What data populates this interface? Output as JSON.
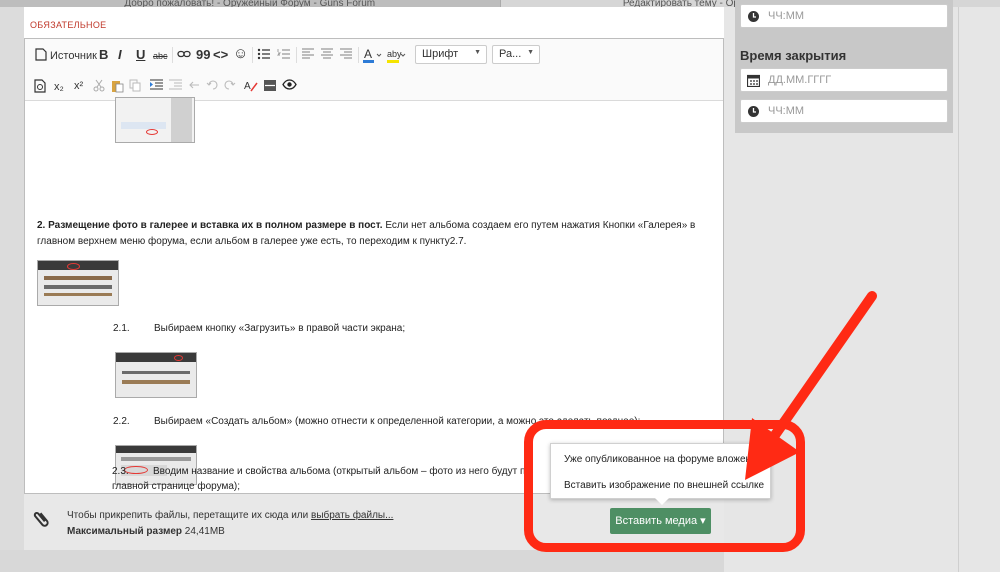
{
  "tabs": [
    "Добро пожаловать! - Оружейный Форум - Guns Forum",
    "Редактировать тему - Оружейный Форум - Guns Forum"
  ],
  "required_label": "ОБЯЗАТЕЛЬНОЕ",
  "toolbar": {
    "source_label": "Источник",
    "font_dropdown": "Шрифт",
    "size_dropdown": "Ра...",
    "bold": "B",
    "italic": "I",
    "underline": "U",
    "strike": "abc",
    "quote": "99",
    "code": "<>",
    "smiley": "☺",
    "subscript": "x₂",
    "superscript": "x²"
  },
  "content": {
    "p2_bold": "2. Размещение фото в галерее и вставка их в полном размере в пост.",
    "p2_text": " Если нет альбома создаем его путем нажатия Кнопки «Галерея» в главном верхнем меню форума, если альбом в галерее уже есть, то переходим к пункту2.7.",
    "s21_num": "2.1.",
    "s21_text": "Выбираем кнопку «Загрузить» в правой части экрана;",
    "s22_num": "2.2.",
    "s22_text": "Выбираем «Создать альбом» (можно отнести к определенной категории, а можно это сделать позднее);",
    "s23_num": "2.3.",
    "s23_text": "Вводим название и свойства альбома (открытый альбом – фото из него будут пр",
    "s23_cont": "главной странице форума);"
  },
  "attach": {
    "hint_prefix": "Чтобы прикрепить файлы, перетащите их сюда или ",
    "hint_link": "выбрать файлы...",
    "max_label": "Максимальный размер",
    "max_value": "24,41MB"
  },
  "right": {
    "time_placeholder": "ЧЧ:ММ",
    "close_title": "Время закрытия",
    "date_placeholder": "ДД.ММ.ГГГГ",
    "time2_placeholder": "ЧЧ:ММ"
  },
  "popup": {
    "item1": "Уже опубликованное на форуме вложение",
    "item2": "Вставить изображение по внешней ссылке"
  },
  "insert_media_button": "Вставить медиа ▾",
  "colors": {
    "accent_green": "#4e8f64",
    "annotation_red": "#ff2a14",
    "required_red": "#c0392b"
  }
}
